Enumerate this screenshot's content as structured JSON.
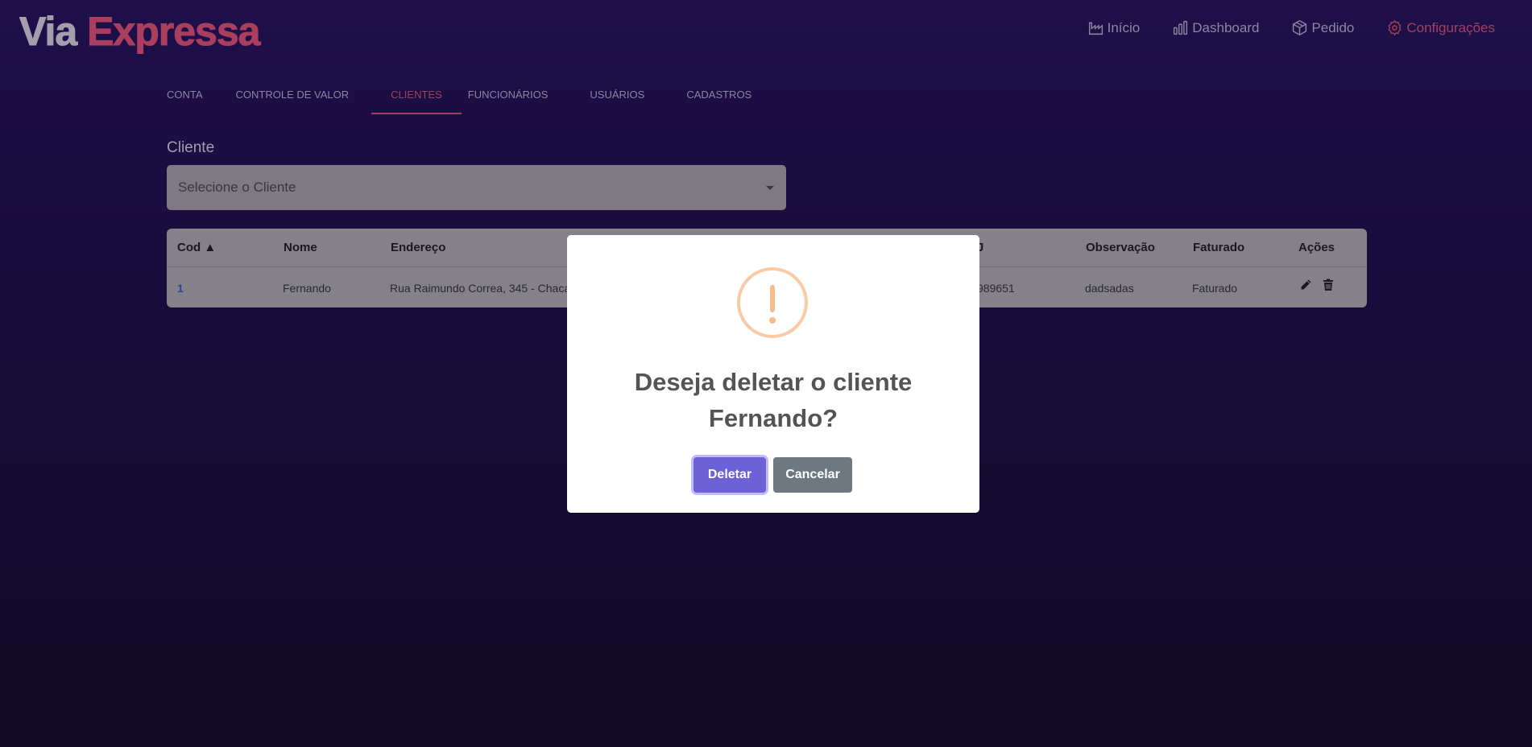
{
  "header": {
    "logo_part1": "Via",
    "logo_part2": "Expressa",
    "nav": [
      {
        "label": "Início",
        "icon": "factory-icon"
      },
      {
        "label": "Dashboard",
        "icon": "bar-chart-icon"
      },
      {
        "label": "Pedido",
        "icon": "box-icon"
      },
      {
        "label": "Configurações",
        "icon": "gear-icon"
      }
    ],
    "active_nav": "Configurações"
  },
  "tabs": [
    "CONTA",
    "CONTROLE DE VALOR",
    "CLIENTES",
    "FUNCIONÁRIOS",
    "USUÁRIOS",
    "CADASTROS"
  ],
  "active_tab": "CLIENTES",
  "client_select": {
    "label": "Cliente",
    "placeholder": "Selecione o Cliente"
  },
  "table": {
    "columns": [
      "Cod ▲",
      "Nome",
      "Endereço",
      "J",
      "Observação",
      "Faturado",
      "Ações"
    ],
    "rows": [
      {
        "cod": "1",
        "nome": "Fernando",
        "endereco": "Rua Raimundo Correa, 345 - Chacar",
        "partial": "989651",
        "observacao": "dadsadas",
        "faturado": "Faturado"
      }
    ]
  },
  "modal": {
    "icon": "warning-icon",
    "title": "Deseja deletar o cliente Fernando?",
    "confirm_label": "Deletar",
    "cancel_label": "Cancelar"
  },
  "colors": {
    "accent": "#a63f5d",
    "confirm": "#6e61d8",
    "cancel": "#6e7881",
    "warning": "#f8cba5"
  }
}
